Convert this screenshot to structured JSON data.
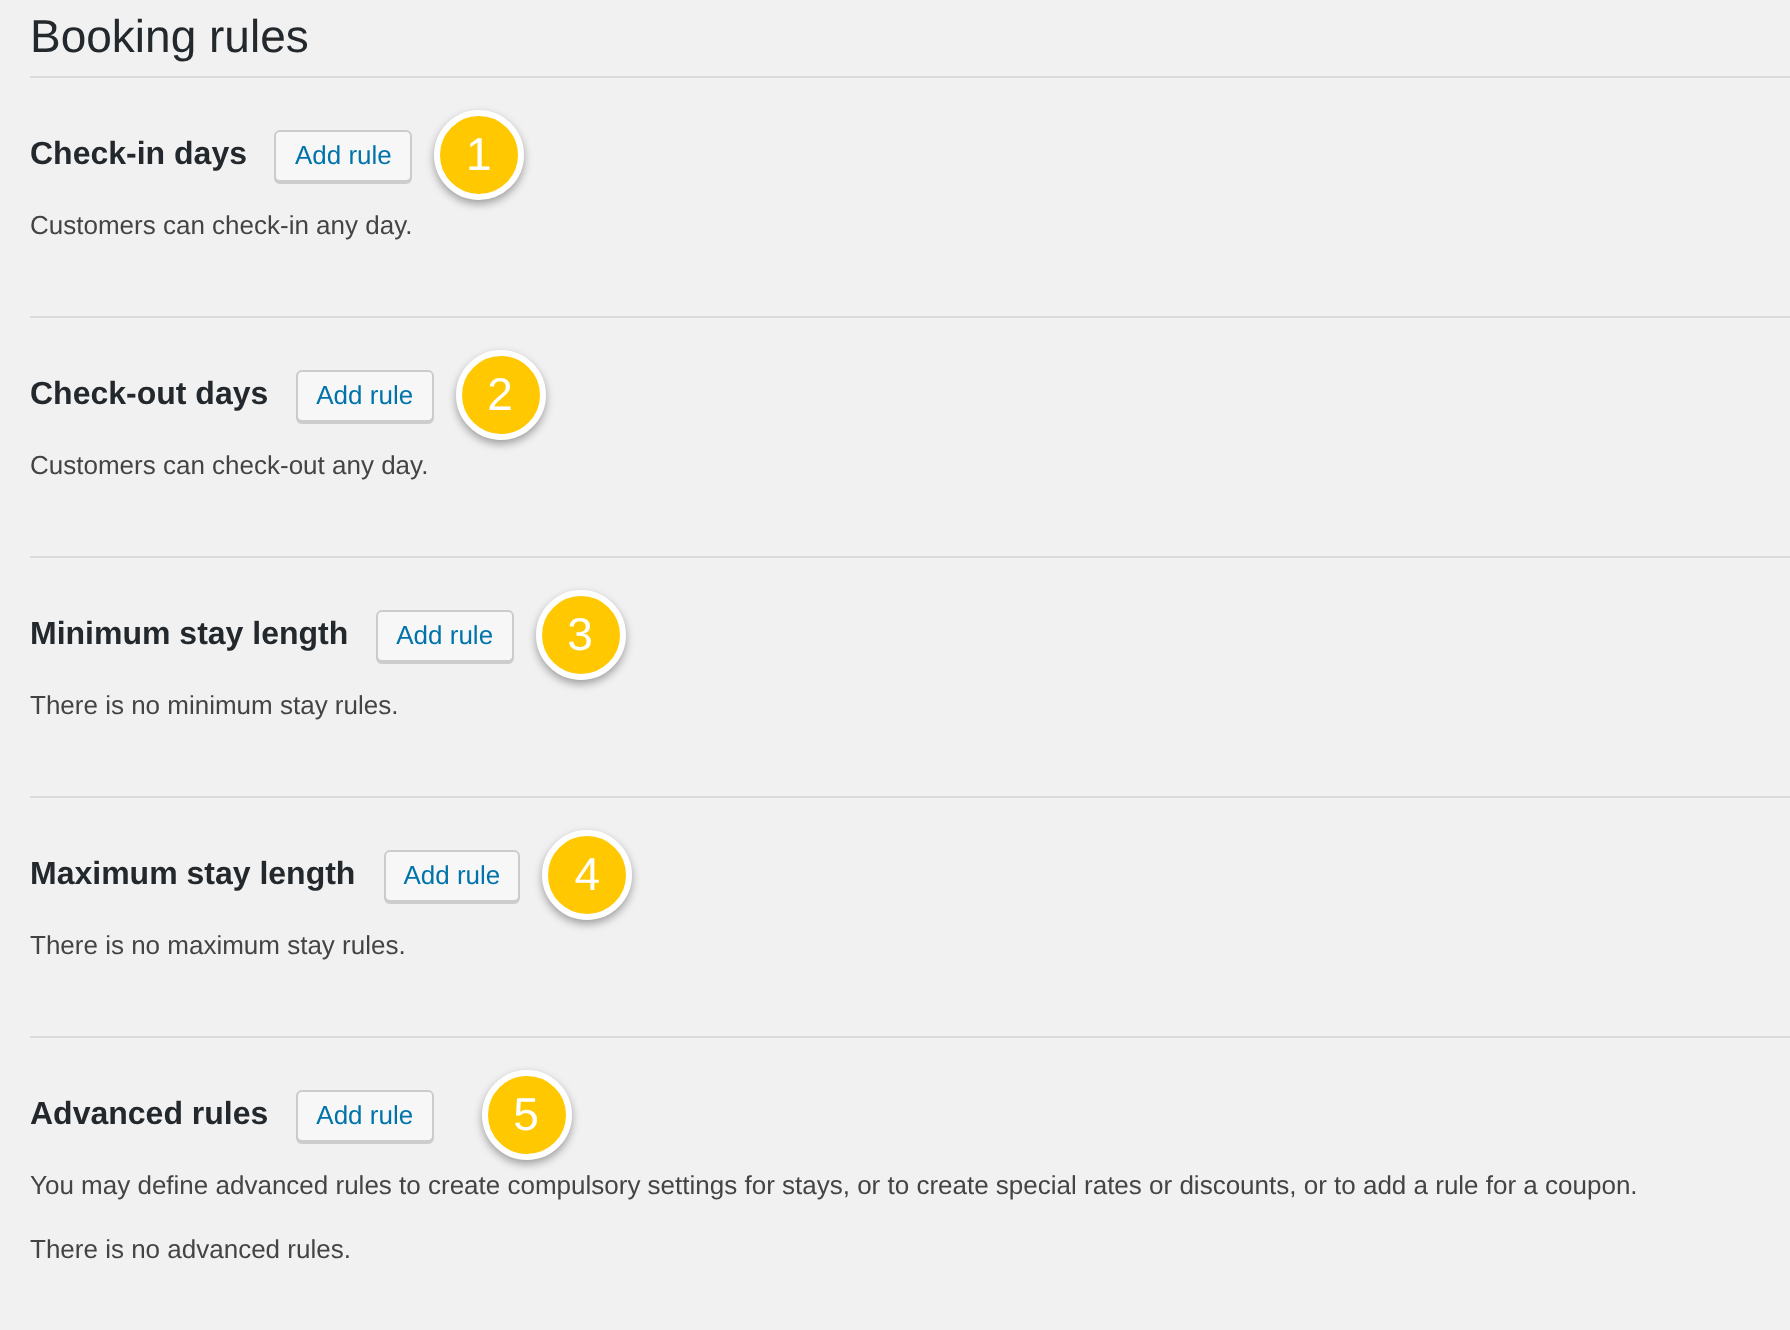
{
  "page": {
    "title": "Booking rules"
  },
  "sections": [
    {
      "heading": "Check-in days",
      "button": "Add rule",
      "badge": "1",
      "paragraphs": [
        "Customers can check-in any day."
      ]
    },
    {
      "heading": "Check-out days",
      "button": "Add rule",
      "badge": "2",
      "paragraphs": [
        "Customers can check-out any day."
      ]
    },
    {
      "heading": "Minimum stay length",
      "button": "Add rule",
      "badge": "3",
      "paragraphs": [
        "There is no minimum stay rules."
      ]
    },
    {
      "heading": "Maximum stay length",
      "button": "Add rule",
      "badge": "4",
      "paragraphs": [
        "There is no maximum stay rules."
      ]
    },
    {
      "heading": "Advanced rules",
      "button": "Add rule",
      "badge": "5",
      "paragraphs": [
        "You may define advanced rules to create compulsory settings for stays, or to create special rates or discounts, or to add a rule for a coupon.",
        "There is no advanced rules."
      ]
    }
  ]
}
